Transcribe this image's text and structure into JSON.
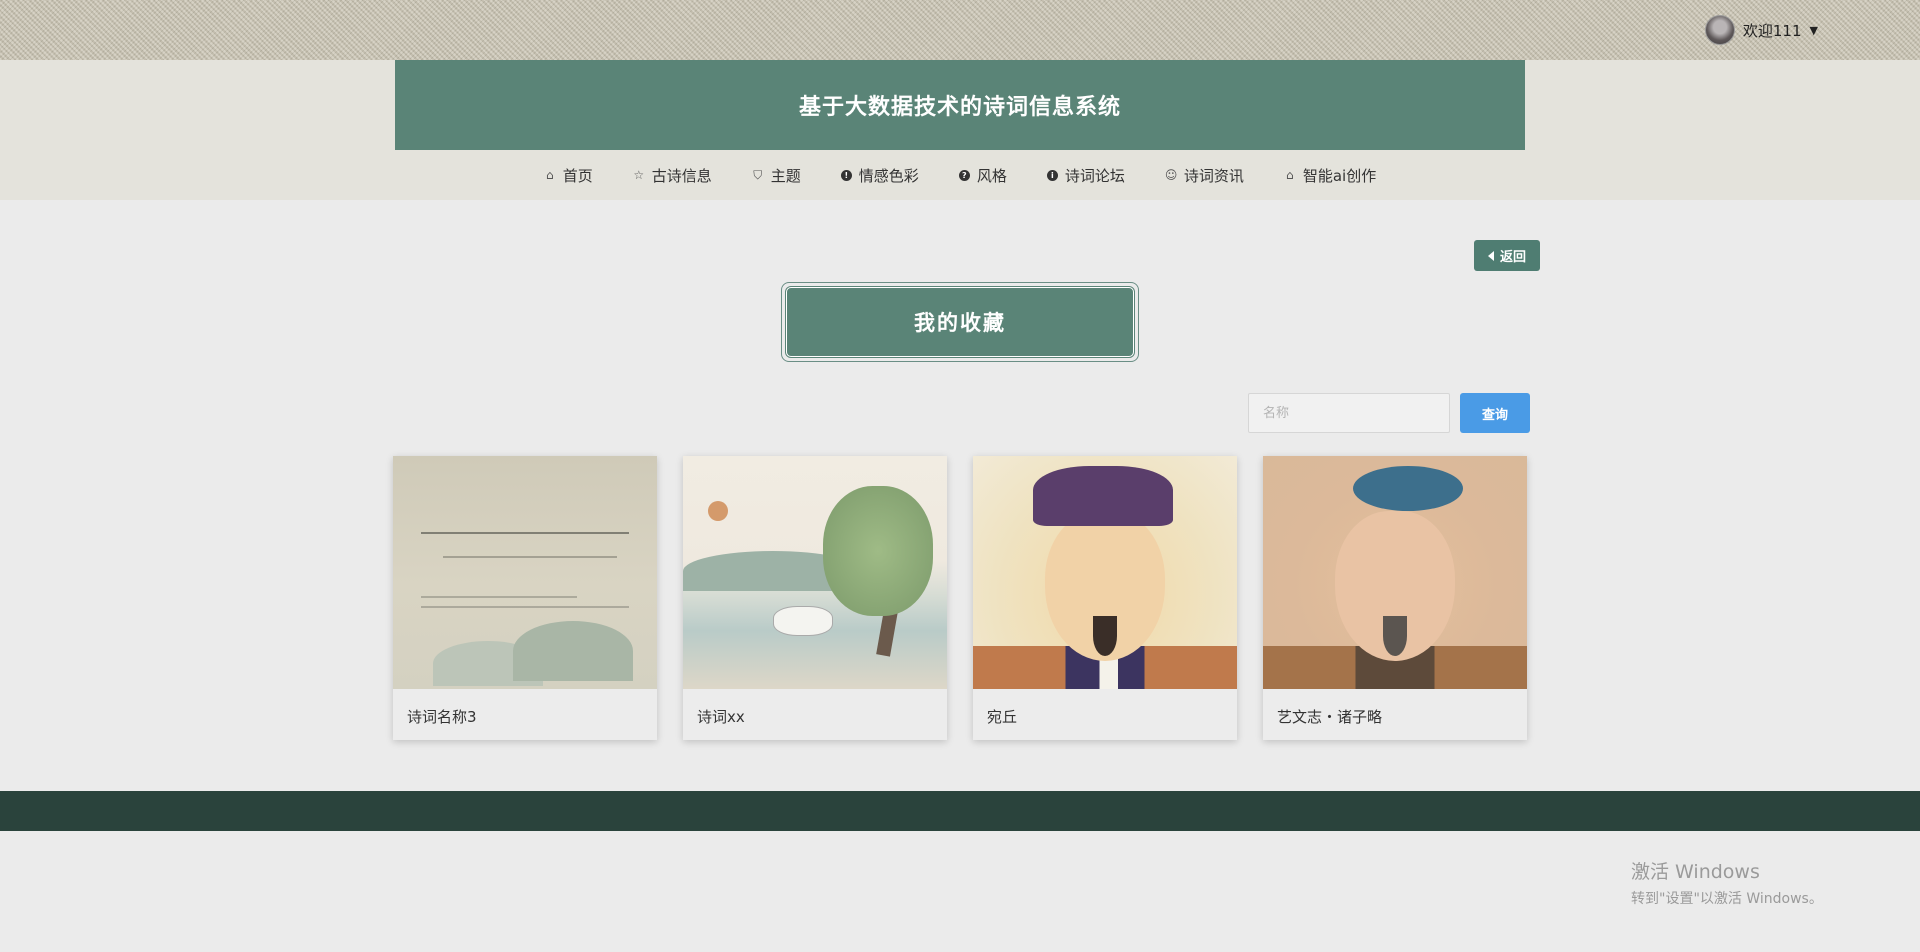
{
  "topbar": {
    "welcome_text": "欢迎111"
  },
  "header": {
    "site_title": "基于大数据技术的诗词信息系统"
  },
  "nav": {
    "items": [
      {
        "label": "首页",
        "icon": "home-icon"
      },
      {
        "label": "古诗信息",
        "icon": "star-icon"
      },
      {
        "label": "主题",
        "icon": "bag-icon"
      },
      {
        "label": "情感色彩",
        "icon": "alert-icon"
      },
      {
        "label": "风格",
        "icon": "question-icon"
      },
      {
        "label": "诗词论坛",
        "icon": "info-icon"
      },
      {
        "label": "诗词资讯",
        "icon": "smile-icon"
      },
      {
        "label": "智能ai创作",
        "icon": "home-icon"
      }
    ]
  },
  "page": {
    "back_label": "返回",
    "section_title": "我的收藏"
  },
  "search": {
    "placeholder": "名称",
    "value": "",
    "button_label": "查询"
  },
  "cards": [
    {
      "name": "诗词名称3"
    },
    {
      "name": "诗词xx"
    },
    {
      "name": "宛丘"
    },
    {
      "name": "艺文志・诸子略"
    }
  ],
  "watermark": {
    "line1": "激活 Windows",
    "line2": "转到\"设置\"以激活 Windows。"
  },
  "colors": {
    "brand_green": "#5a8477",
    "footer_dark": "#2a433c",
    "search_blue": "#4a9be6"
  }
}
